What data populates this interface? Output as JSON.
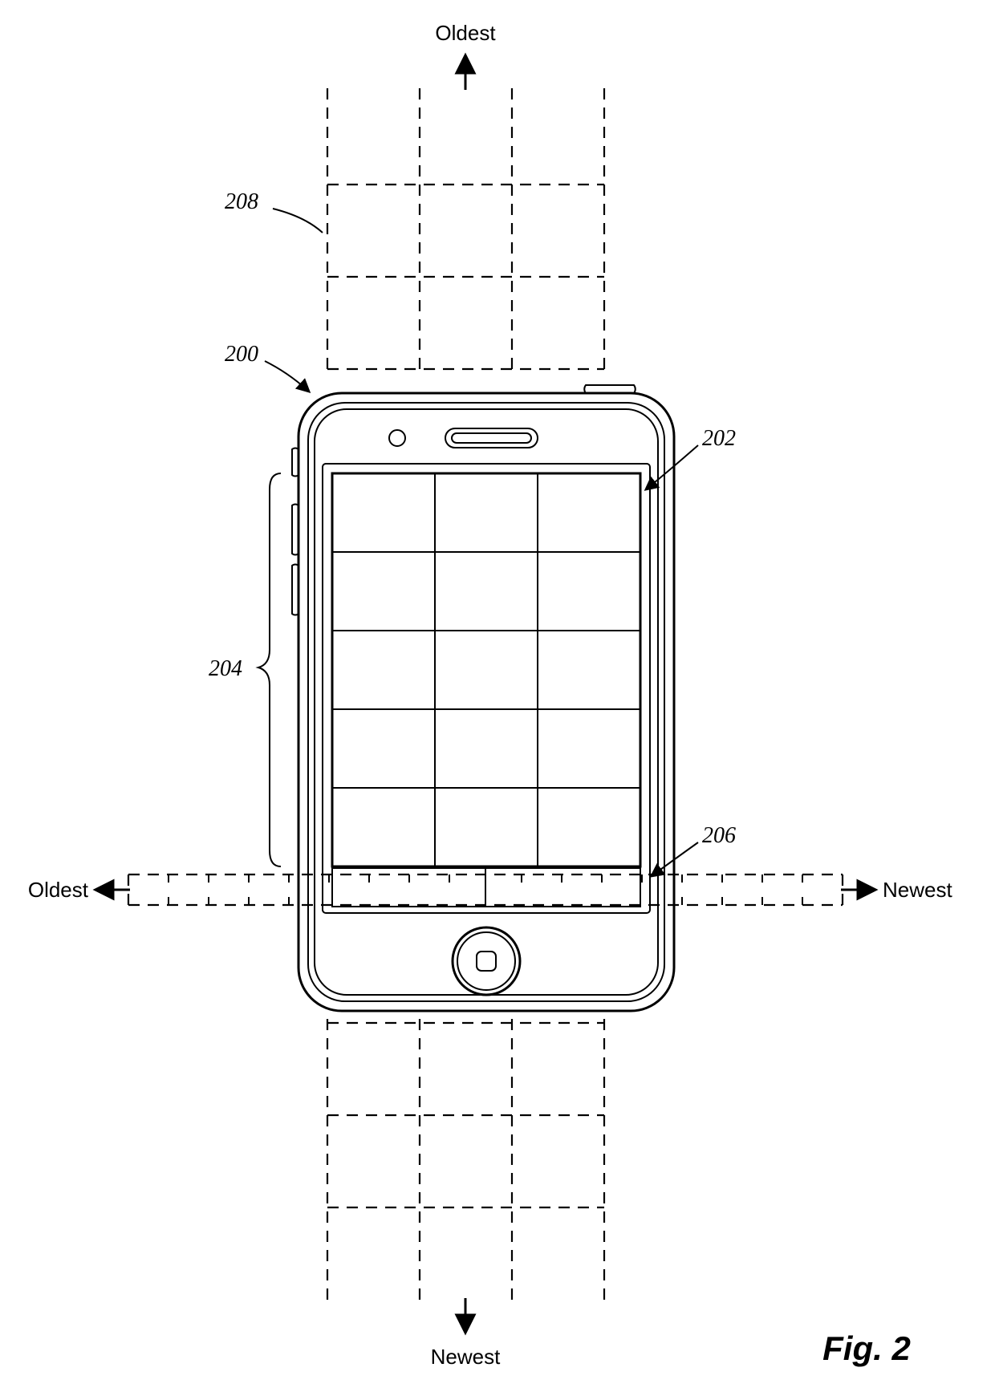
{
  "labels": {
    "top": "Oldest",
    "bottom": "Newest",
    "left": "Oldest",
    "right": "Newest",
    "ref200": "200",
    "ref202": "202",
    "ref204": "204",
    "ref206": "206",
    "ref208": "208"
  },
  "figure": "Fig. 2"
}
